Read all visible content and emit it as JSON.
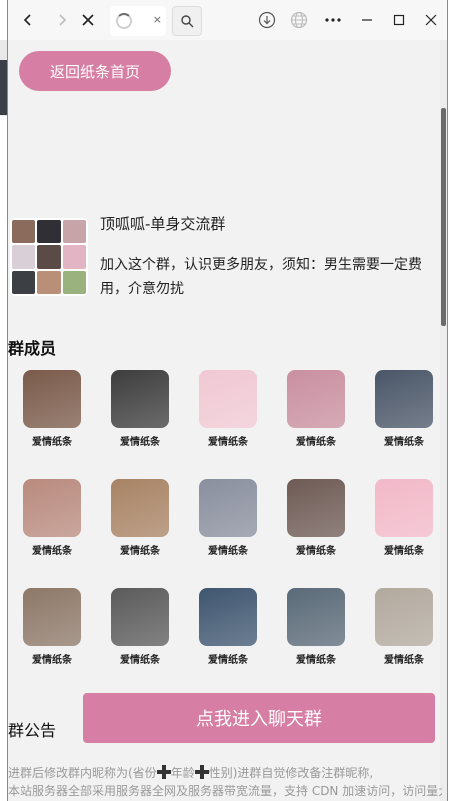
{
  "browser": {
    "tab_close_glyph": "×",
    "icons": [
      "back-icon",
      "forward-icon",
      "close-icon",
      "loading-spinner-icon",
      "search-icon",
      "download-icon",
      "globe-icon",
      "more-icon",
      "minimize-icon",
      "maximize-icon",
      "window-close-icon"
    ]
  },
  "page": {
    "back_button": "返回纸条首页",
    "group": {
      "name": "顶呱呱-单身交流群",
      "description": "加入这个群，认识更多朋友，须知：男生需要一定费用，介意勿扰"
    },
    "members_title": "群成员",
    "members": [
      {
        "name": "爱情纸条",
        "color": "#7a5a4a"
      },
      {
        "name": "爱情纸条",
        "color": "#3d3d3d"
      },
      {
        "name": "爱情纸条",
        "color": "#f0c8d4"
      },
      {
        "name": "爱情纸条",
        "color": "#c98fa0"
      },
      {
        "name": "爱情纸条",
        "color": "#4a5668"
      },
      {
        "name": "爱情纸条",
        "color": "#b98a7e"
      },
      {
        "name": "爱情纸条",
        "color": "#a88364"
      },
      {
        "name": "爱情纸条",
        "color": "#8a8f9e"
      },
      {
        "name": "爱情纸条",
        "color": "#6e5a55"
      },
      {
        "name": "爱情纸条",
        "color": "#f2b8c8"
      },
      {
        "name": "爱情纸条",
        "color": "#8d7868"
      },
      {
        "name": "爱情纸条",
        "color": "#5b5b5b"
      },
      {
        "name": "爱情纸条",
        "color": "#3f5670"
      },
      {
        "name": "爱情纸条",
        "color": "#5a6a78"
      },
      {
        "name": "爱情纸条",
        "color": "#b2a99e"
      }
    ],
    "notice_title": "群公告",
    "enter_button": "点我进入聊天群",
    "notice_line1_a": "进群后修改群内昵称为(省份",
    "notice_line1_b": "年龄",
    "notice_line1_c": "性别)进群自觉修改备注群昵称,",
    "notice_line2": "本站服务器全部采用服务器全网及服务器带宽流量，支持 CDN 加速访问，访问量大时推荐使用。"
  },
  "colors": {
    "accent": "#d67ea3",
    "window_bg": "#f2f2f2"
  }
}
